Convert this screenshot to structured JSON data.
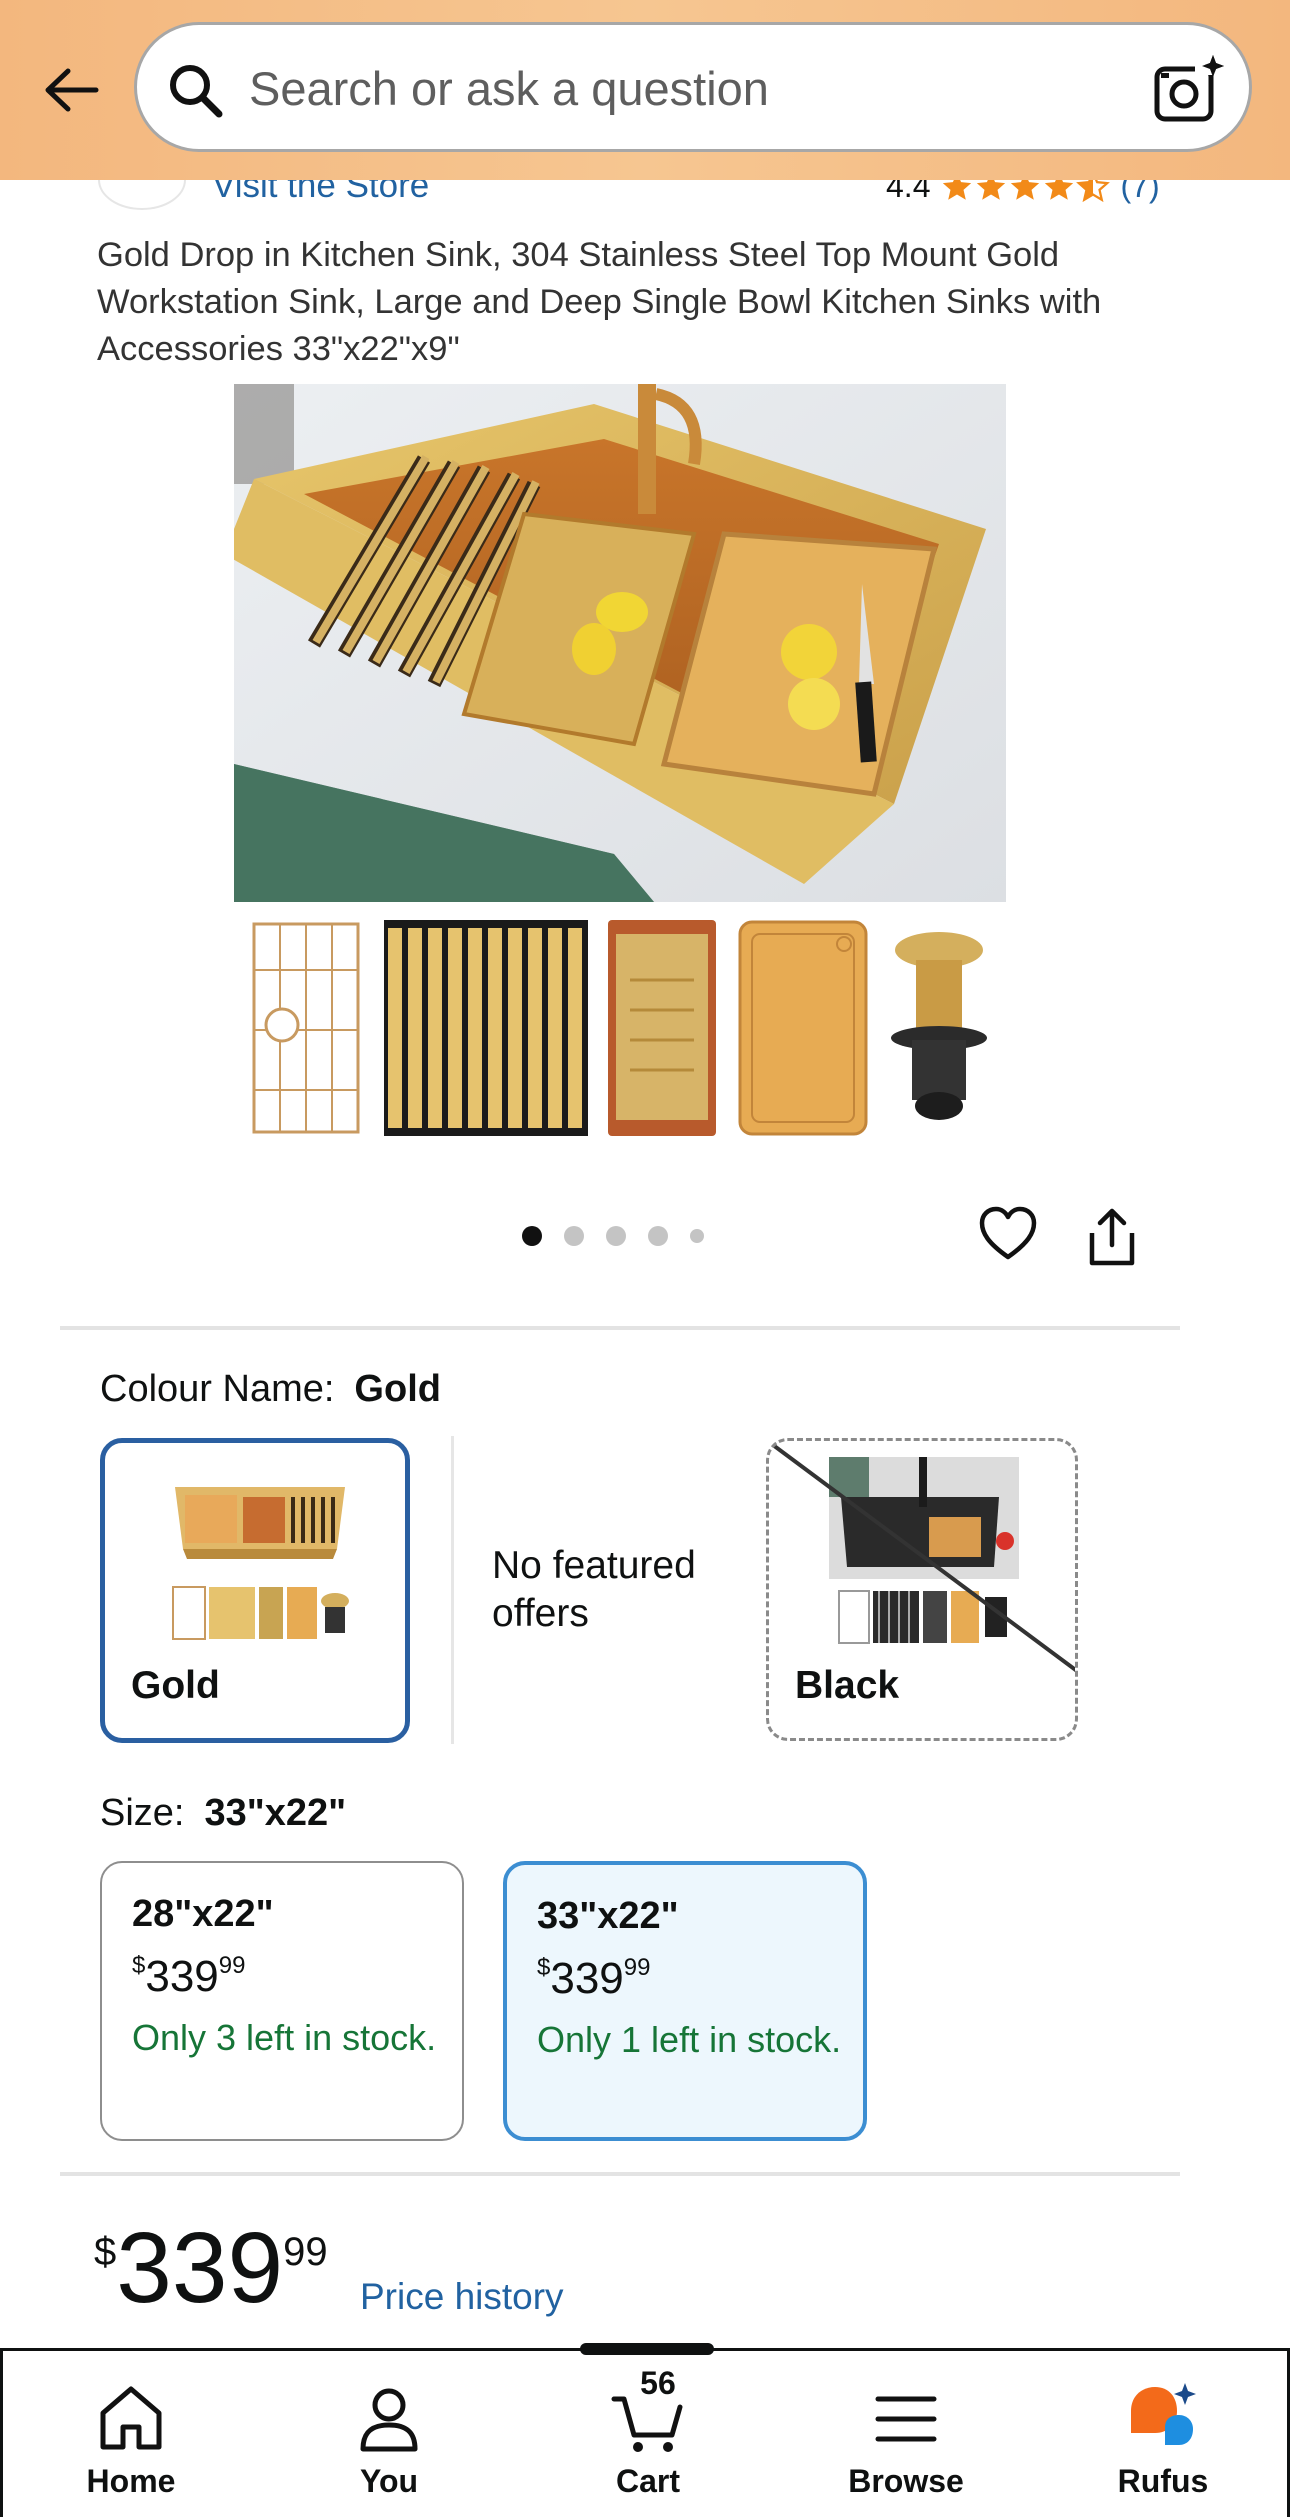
{
  "header": {
    "search_placeholder": "Search or ask a question"
  },
  "store": {
    "visit_label": "Visit the Store",
    "rating_value": "4.4",
    "rating_count": "(7)",
    "star_color": "#f28a18"
  },
  "product": {
    "title": "Gold Drop in Kitchen Sink, 304 Stainless Steel Top Mount Gold Workstation Sink, Large and Deep Single Bowl Kitchen Sinks with Accessories 33\"x22\"x9\""
  },
  "colour": {
    "label": "Colour Name:",
    "selected": "Gold",
    "options": [
      {
        "name": "Gold"
      },
      {
        "name": "Black"
      }
    ],
    "no_offers": "No featured offers"
  },
  "size": {
    "label": "Size:",
    "selected": "33\"x22\"",
    "options": [
      {
        "name": "28\"x22\"",
        "currency": "$",
        "whole": "339",
        "fraction": "99",
        "stock": "Only 3 left in stock."
      },
      {
        "name": "33\"x22\"",
        "currency": "$",
        "whole": "339",
        "fraction": "99",
        "stock": "Only 1 left in stock."
      }
    ]
  },
  "price": {
    "currency": "$",
    "whole": "339",
    "fraction": "99",
    "history_label": "Price history"
  },
  "nav": {
    "home": "Home",
    "you": "You",
    "cart": "Cart",
    "cart_count": "56",
    "browse": "Browse",
    "rufus": "Rufus"
  },
  "colors": {
    "link": "#2162a1",
    "stock_green": "#167537",
    "selected_border": "#2a5fa1",
    "size_selected_bg": "#edf7fd",
    "header_bg": "#f3b77e"
  }
}
